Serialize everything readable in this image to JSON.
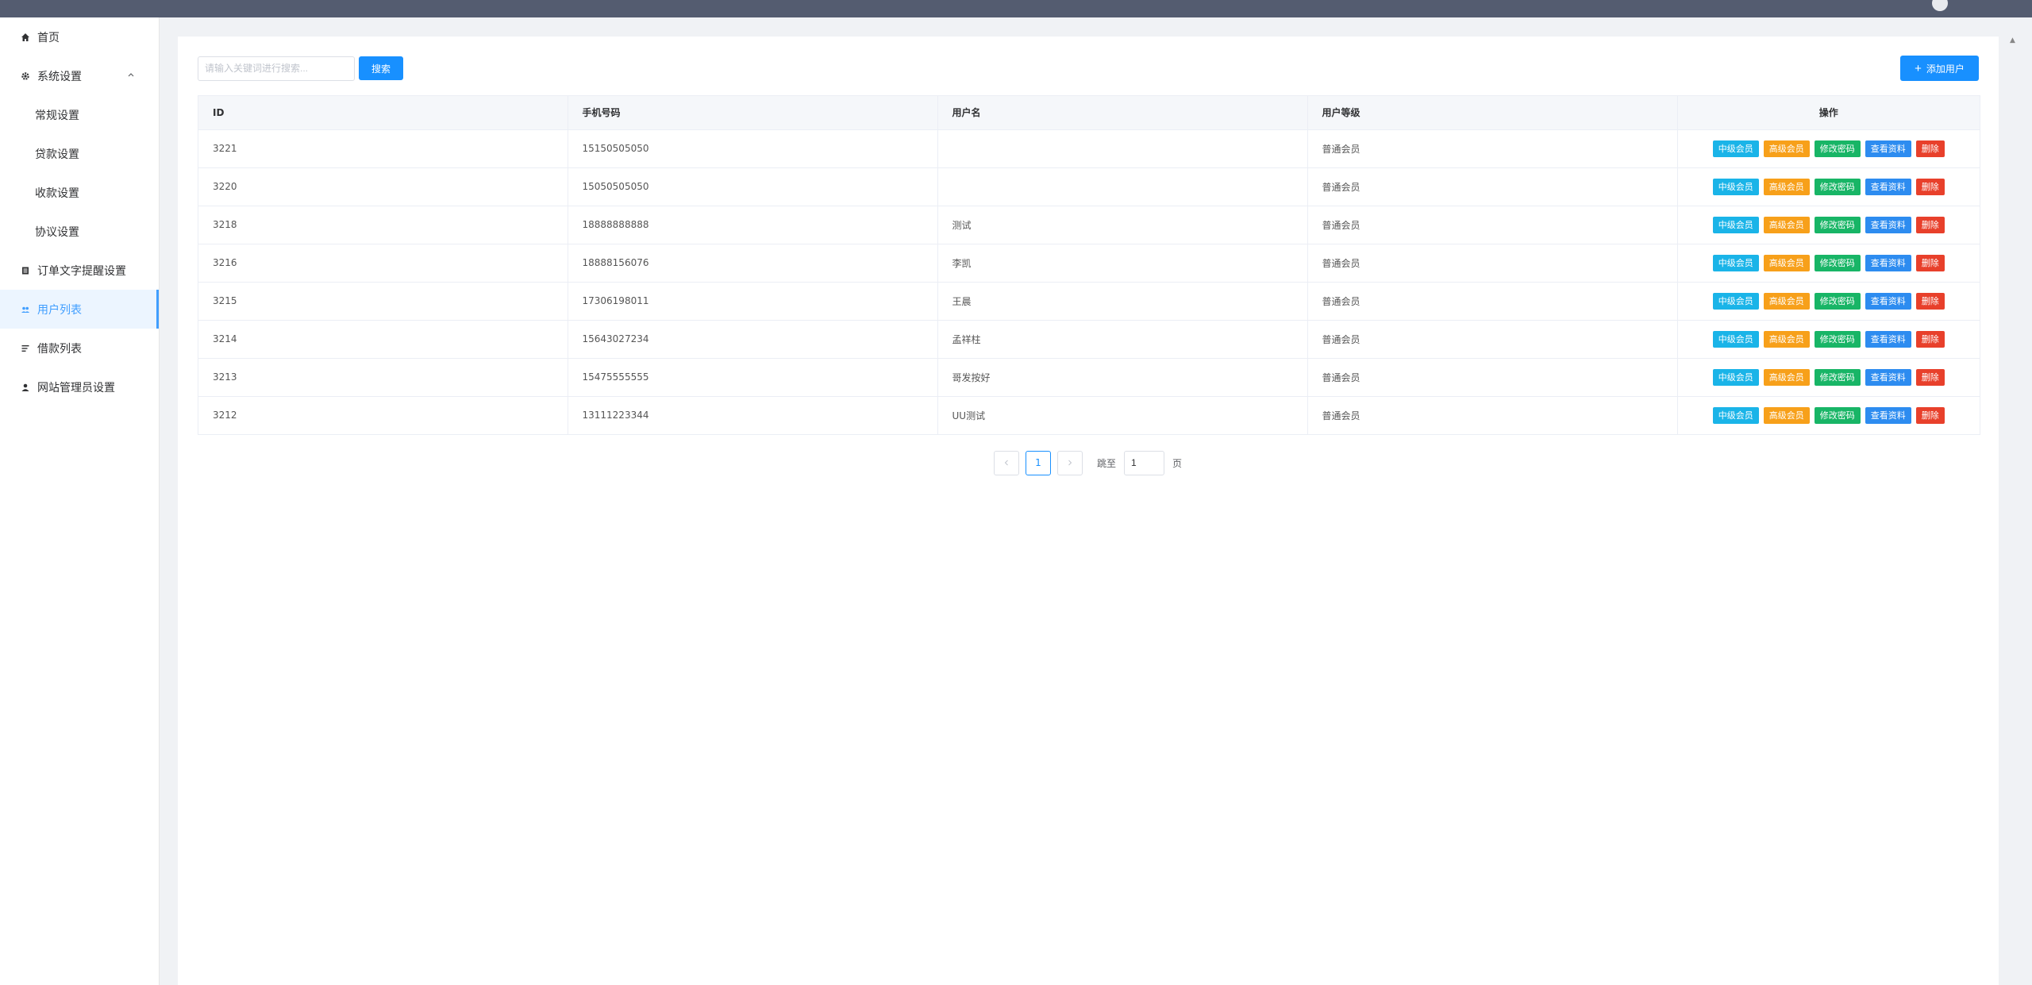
{
  "sidebar": {
    "items": [
      {
        "label": "首页",
        "icon": "home-icon"
      },
      {
        "label": "系统设置",
        "icon": "gear-icon"
      },
      {
        "label": "常规设置"
      },
      {
        "label": "贷款设置"
      },
      {
        "label": "收款设置"
      },
      {
        "label": "协议设置"
      },
      {
        "label": "订单文字提醒设置",
        "icon": "document-icon"
      },
      {
        "label": "用户列表",
        "icon": "users-icon"
      },
      {
        "label": "借款列表",
        "icon": "list-icon"
      },
      {
        "label": "网站管理员设置",
        "icon": "user-icon"
      }
    ],
    "active_index": 7
  },
  "toolbar": {
    "search_placeholder": "请输入关键词进行搜索...",
    "search_label": "搜索",
    "add_user_label": "添加用户"
  },
  "table": {
    "columns": [
      "ID",
      "手机号码",
      "用户名",
      "用户等级",
      "操作"
    ],
    "actions": [
      "中级会员",
      "高级会员",
      "修改密码",
      "查看资料",
      "删除"
    ],
    "rows": [
      {
        "id": "3221",
        "phone": "15150505050",
        "username": "",
        "level": "普通会员"
      },
      {
        "id": "3220",
        "phone": "15050505050",
        "username": "",
        "level": "普通会员"
      },
      {
        "id": "3218",
        "phone": "18888888888",
        "username": "测试",
        "level": "普通会员"
      },
      {
        "id": "3216",
        "phone": "18888156076",
        "username": "李凯",
        "level": "普通会员"
      },
      {
        "id": "3215",
        "phone": "17306198011",
        "username": "王晨",
        "level": "普通会员"
      },
      {
        "id": "3214",
        "phone": "15643027234",
        "username": "孟祥柱",
        "level": "普通会员"
      },
      {
        "id": "3213",
        "phone": "15475555555",
        "username": "哥发按好",
        "level": "普通会员"
      },
      {
        "id": "3212",
        "phone": "13111223344",
        "username": "UU测试",
        "level": "普通会员"
      }
    ]
  },
  "pagination": {
    "current_page": "1",
    "jump_label": "跳至",
    "jump_value": "1",
    "page_unit": "页"
  },
  "colors": {
    "primary": "#1890ff",
    "topbar": "#545c70",
    "mid": "#1ab4e8",
    "high": "#f7a01a",
    "pwd": "#18b566",
    "view": "#2d8cf0",
    "del": "#e8402b"
  }
}
